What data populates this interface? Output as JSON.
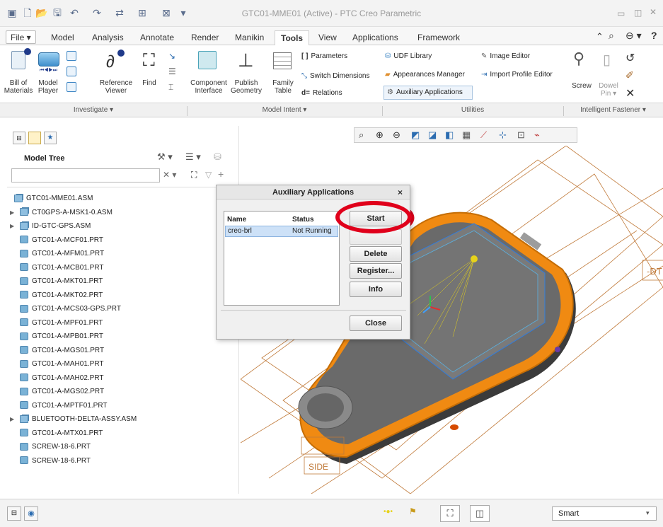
{
  "window": {
    "title": "GTC01-MME01 (Active) - PTC Creo Parametric"
  },
  "menu_tabs": [
    "File",
    "Model",
    "Analysis",
    "Annotate",
    "Render",
    "Manikin",
    "Tools",
    "View",
    "Applications",
    "Framework"
  ],
  "active_tab": "Tools",
  "ribbon": {
    "investigate": {
      "bill_of_materials": "Bill of\nMaterials",
      "model_player": "Model\nPlayer",
      "reference_viewer": "Reference\nViewer",
      "find": "Find",
      "group_label": "Investigate ▾"
    },
    "model_intent": {
      "component_interface": "Component\nInterface",
      "publish_geometry": "Publish\nGeometry",
      "family_table": "Family\nTable",
      "parameters": "Parameters",
      "switch_dimensions": "Switch Dimensions",
      "relations": "Relations",
      "group_label": "Model Intent ▾"
    },
    "utilities": {
      "udf_library": "UDF Library",
      "image_editor": "Image Editor",
      "appearances_manager": "Appearances Manager",
      "import_profile_editor": "Import Profile Editor",
      "auxiliary_applications": "Auxiliary Applications",
      "group_label": "Utilities"
    },
    "intelligent_fastener": {
      "screw": "Screw",
      "dowel_pin": "Dowel\nPin ▾",
      "group_label": "Intelligent Fastener ▾"
    }
  },
  "model_tree": {
    "title": "Model Tree",
    "items": [
      {
        "label": "GTC01-MME01.ASM",
        "type": "asm",
        "expand": "",
        "indent": 0
      },
      {
        "label": "CT0GPS-A-MSK1-0.ASM",
        "type": "asm",
        "expand": "▶",
        "indent": 1
      },
      {
        "label": "ID-GTC-GPS.ASM",
        "type": "asm",
        "expand": "▶",
        "indent": 1
      },
      {
        "label": "GTC01-A-MCF01.PRT",
        "type": "prt",
        "expand": "",
        "indent": 1
      },
      {
        "label": "GTC01-A-MFM01.PRT",
        "type": "prt",
        "expand": "",
        "indent": 1
      },
      {
        "label": "GTC01-A-MCB01.PRT",
        "type": "prt",
        "expand": "",
        "indent": 1
      },
      {
        "label": "GTC01-A-MKT01.PRT",
        "type": "prt",
        "expand": "",
        "indent": 1
      },
      {
        "label": "GTC01-A-MKT02.PRT",
        "type": "prt",
        "expand": "",
        "indent": 1
      },
      {
        "label": "GTC01-A-MCS03-GPS.PRT",
        "type": "prt",
        "expand": "",
        "indent": 1
      },
      {
        "label": "GTC01-A-MPF01.PRT",
        "type": "prt",
        "expand": "",
        "indent": 1
      },
      {
        "label": "GTC01-A-MPB01.PRT",
        "type": "prt",
        "expand": "",
        "indent": 1
      },
      {
        "label": "GTC01-A-MGS01.PRT",
        "type": "prt",
        "expand": "",
        "indent": 1
      },
      {
        "label": "GTC01-A-MAH01.PRT",
        "type": "prt",
        "expand": "",
        "indent": 1
      },
      {
        "label": "GTC01-A-MAH02.PRT",
        "type": "prt",
        "expand": "",
        "indent": 1
      },
      {
        "label": "GTC01-A-MGS02.PRT",
        "type": "prt",
        "expand": "",
        "indent": 1
      },
      {
        "label": "GTC01-A-MPTF01.PRT",
        "type": "prt",
        "expand": "",
        "indent": 1
      },
      {
        "label": "BLUETOOTH-DELTA-ASSY.ASM",
        "type": "asm",
        "expand": "▶",
        "indent": 1
      },
      {
        "label": "GTC01-A-MTX01.PRT",
        "type": "prt",
        "expand": "",
        "indent": 1
      },
      {
        "label": "SCREW-18-6.PRT",
        "type": "prt",
        "expand": "",
        "indent": 1
      },
      {
        "label": "SCREW-18-6.PRT",
        "type": "prt",
        "expand": "",
        "indent": 1
      }
    ]
  },
  "dialog": {
    "title": "Auxiliary Applications",
    "close": "×",
    "columns": [
      "Name",
      "Status"
    ],
    "rows": [
      {
        "name": "creo-brl",
        "status": "Not Running"
      }
    ],
    "buttons": {
      "start": "Start",
      "delete": "Delete",
      "register": "Register...",
      "info": "Info",
      "close": "Close"
    }
  },
  "graphics": {
    "datum_label": "-DT",
    "side_label": "SIDE"
  },
  "status": {
    "filter": "Smart"
  },
  "colors": {
    "highlight_ring": "#e0001b",
    "device_orange": "#f08a12",
    "device_gray": "#6a6a6a",
    "selection_blue": "#2f7de0"
  }
}
